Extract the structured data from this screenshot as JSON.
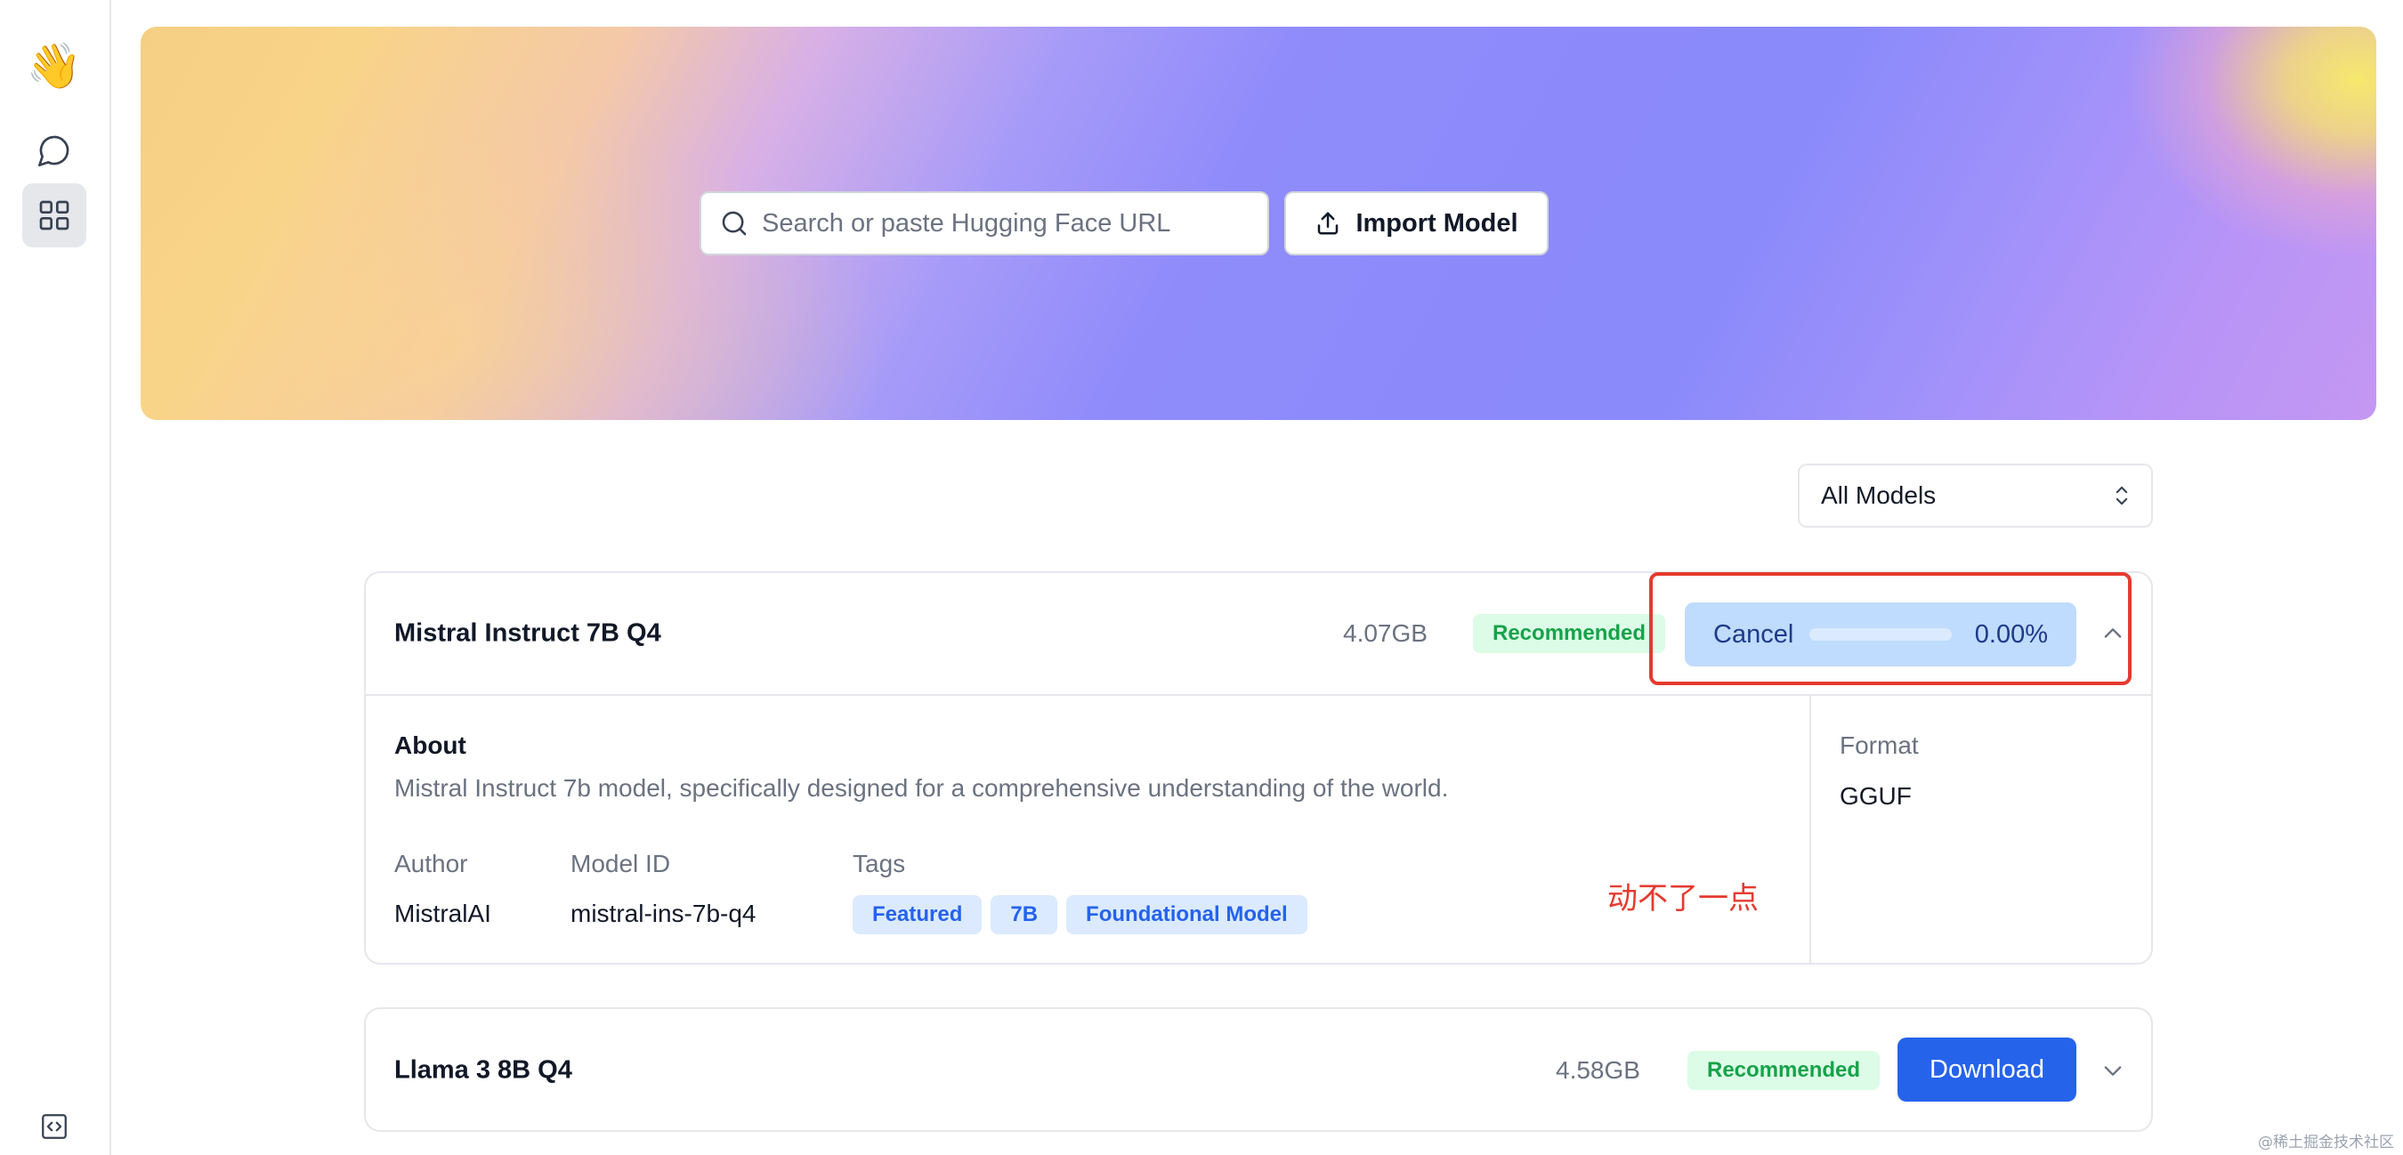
{
  "sidebar": {
    "logo_emoji": "👋",
    "items": [
      {
        "name": "chat",
        "icon": "chat-bubble-icon",
        "active": false
      },
      {
        "name": "hub",
        "icon": "grid-icon",
        "active": true
      }
    ],
    "footer_icon": "code-toggle-icon"
  },
  "hero": {
    "search": {
      "placeholder": "Search or paste Hugging Face URL",
      "value": ""
    },
    "import_label": "Import Model"
  },
  "filter": {
    "selected": "All Models"
  },
  "models": [
    {
      "name": "Mistral Instruct 7B Q4",
      "size": "4.07GB",
      "badge": "Recommended",
      "state": "downloading",
      "cancel_label": "Cancel",
      "progress_fraction": 0.0,
      "progress_text": "0.00%",
      "expanded": true,
      "about_title": "About",
      "description": "Mistral Instruct 7b model, specifically designed for a comprehensive understanding of the world.",
      "labels": {
        "author": "Author",
        "model_id": "Model ID",
        "tags": "Tags",
        "format": "Format"
      },
      "author": "MistralAI",
      "model_id": "mistral-ins-7b-q4",
      "tags": [
        "Featured",
        "7B",
        "Foundational Model"
      ],
      "format": "GGUF"
    },
    {
      "name": "Llama 3 8B Q4",
      "size": "4.58GB",
      "badge": "Recommended",
      "state": "idle",
      "download_label": "Download",
      "expanded": false
    }
  ],
  "annotation": {
    "text": "动不了一点",
    "color": "#e53a2f"
  },
  "watermark": "@稀土掘金技术社区",
  "colors": {
    "primary": "#2563eb",
    "recommended_bg": "#dcfce7",
    "recommended_text": "#16a34a",
    "tag_bg": "#dbeafe",
    "highlight": "#e53a2f"
  }
}
